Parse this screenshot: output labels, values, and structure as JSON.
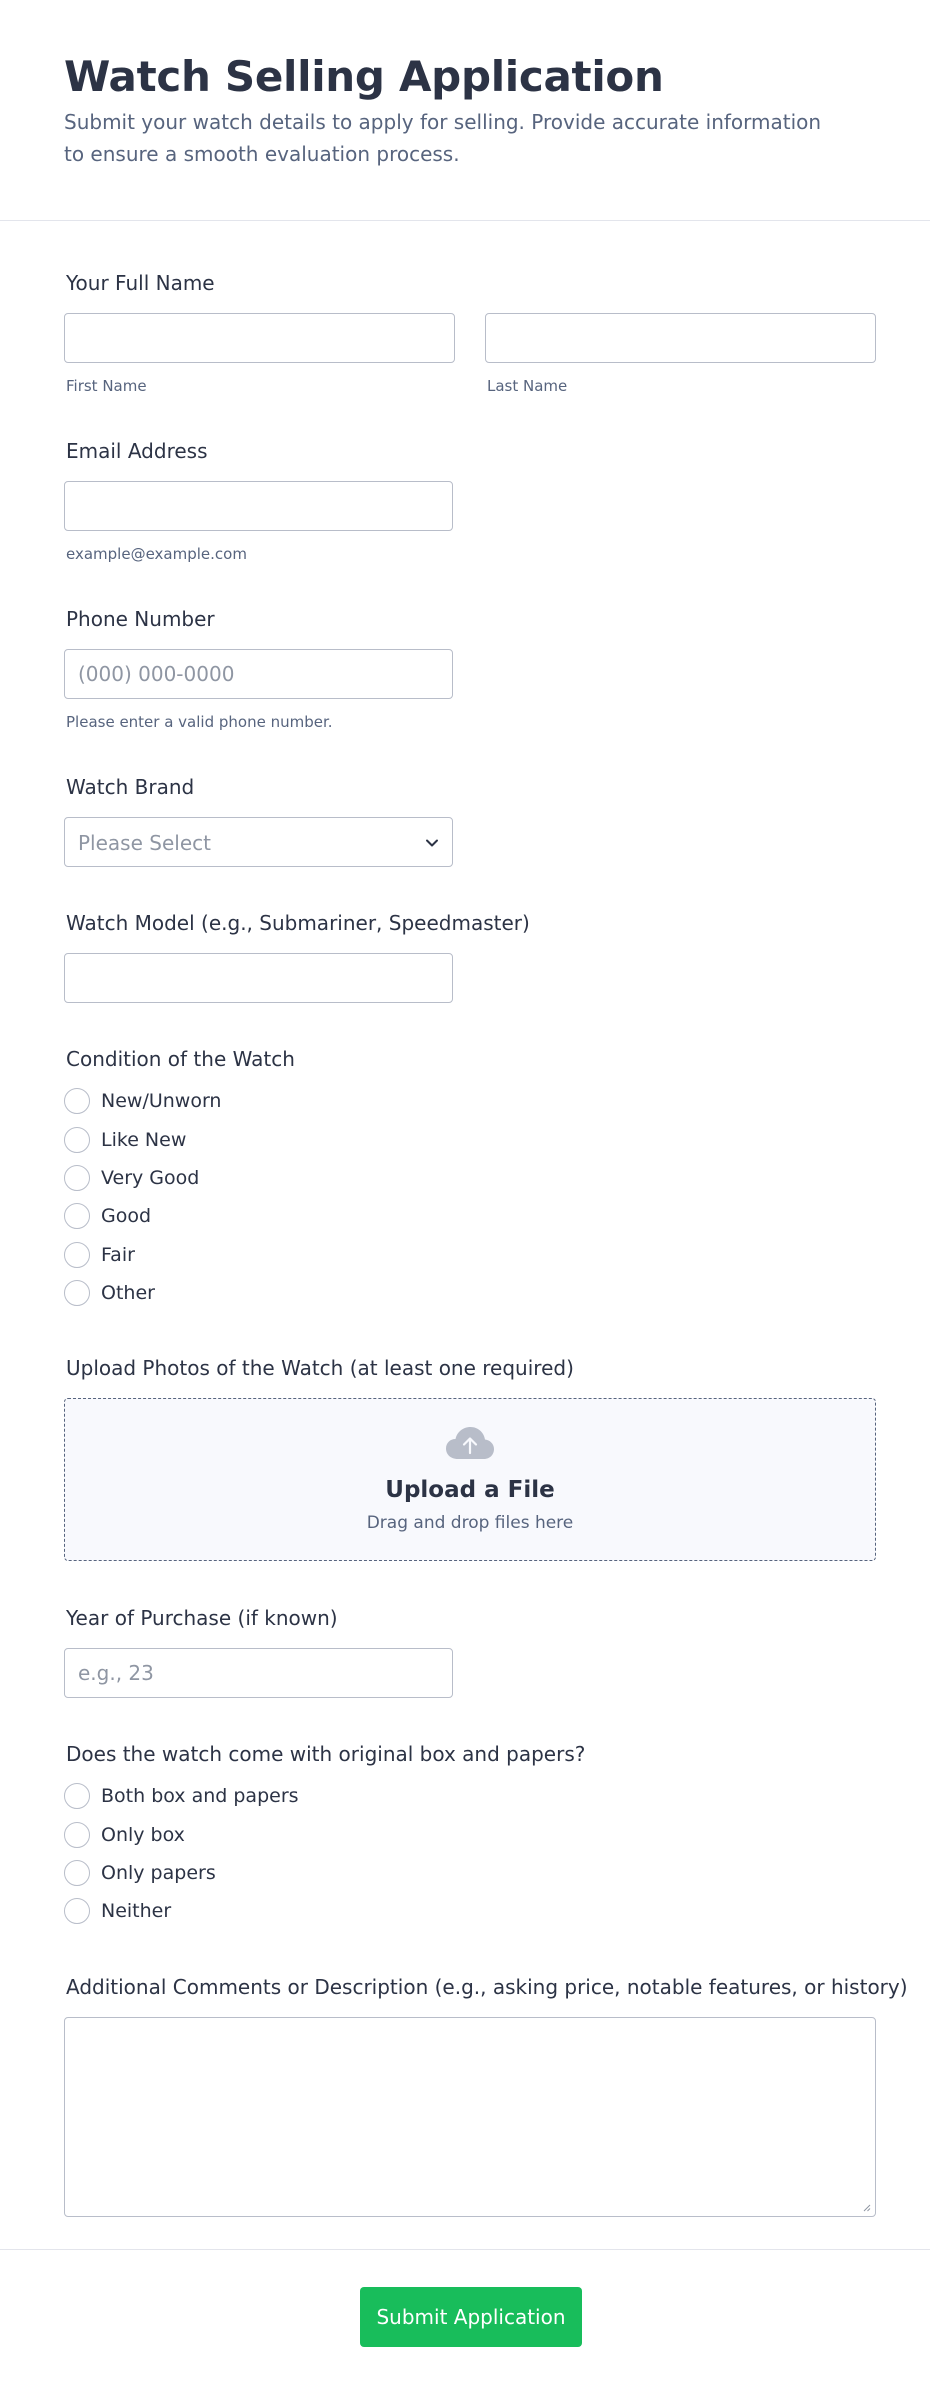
{
  "header": {
    "title": "Watch Selling Application",
    "subtitle": "Submit your watch details to apply for selling. Provide accurate information to ensure a smooth evaluation process."
  },
  "full_name": {
    "label": "Your Full Name",
    "first_sublabel": "First Name",
    "last_sublabel": "Last Name",
    "first_value": "",
    "last_value": ""
  },
  "email": {
    "label": "Email Address",
    "sublabel": "example@example.com",
    "value": ""
  },
  "phone": {
    "label": "Phone Number",
    "placeholder": "(000) 000-0000",
    "sublabel": "Please enter a valid phone number.",
    "value": ""
  },
  "brand": {
    "label": "Watch Brand",
    "selected": "Please Select",
    "chevron_icon": "chevron-down-icon"
  },
  "model": {
    "label": "Watch Model (e.g., Submariner, Speedmaster)",
    "value": ""
  },
  "condition": {
    "label": "Condition of the Watch",
    "options": [
      "New/Unworn",
      "Like New",
      "Very Good",
      "Good",
      "Fair",
      "Other"
    ]
  },
  "photos": {
    "label": "Upload Photos of the Watch (at least one required)",
    "upload_title": "Upload a File",
    "upload_hint": "Drag and drop files here",
    "icon": "cloud-upload-icon"
  },
  "year": {
    "label": "Year of Purchase (if known)",
    "placeholder": "e.g., 23",
    "value": ""
  },
  "box_papers": {
    "label": "Does the watch come with original box and papers?",
    "options": [
      "Both box and papers",
      "Only box",
      "Only papers",
      "Neither"
    ]
  },
  "comments": {
    "label": "Additional Comments or Description (e.g., asking price, notable features, or history)",
    "value": ""
  },
  "submit": {
    "label": "Submit Application"
  },
  "colors": {
    "accent": "#18bd5b",
    "text": "#2c3345",
    "muted": "#57647e",
    "border": "#b8bdc9"
  }
}
